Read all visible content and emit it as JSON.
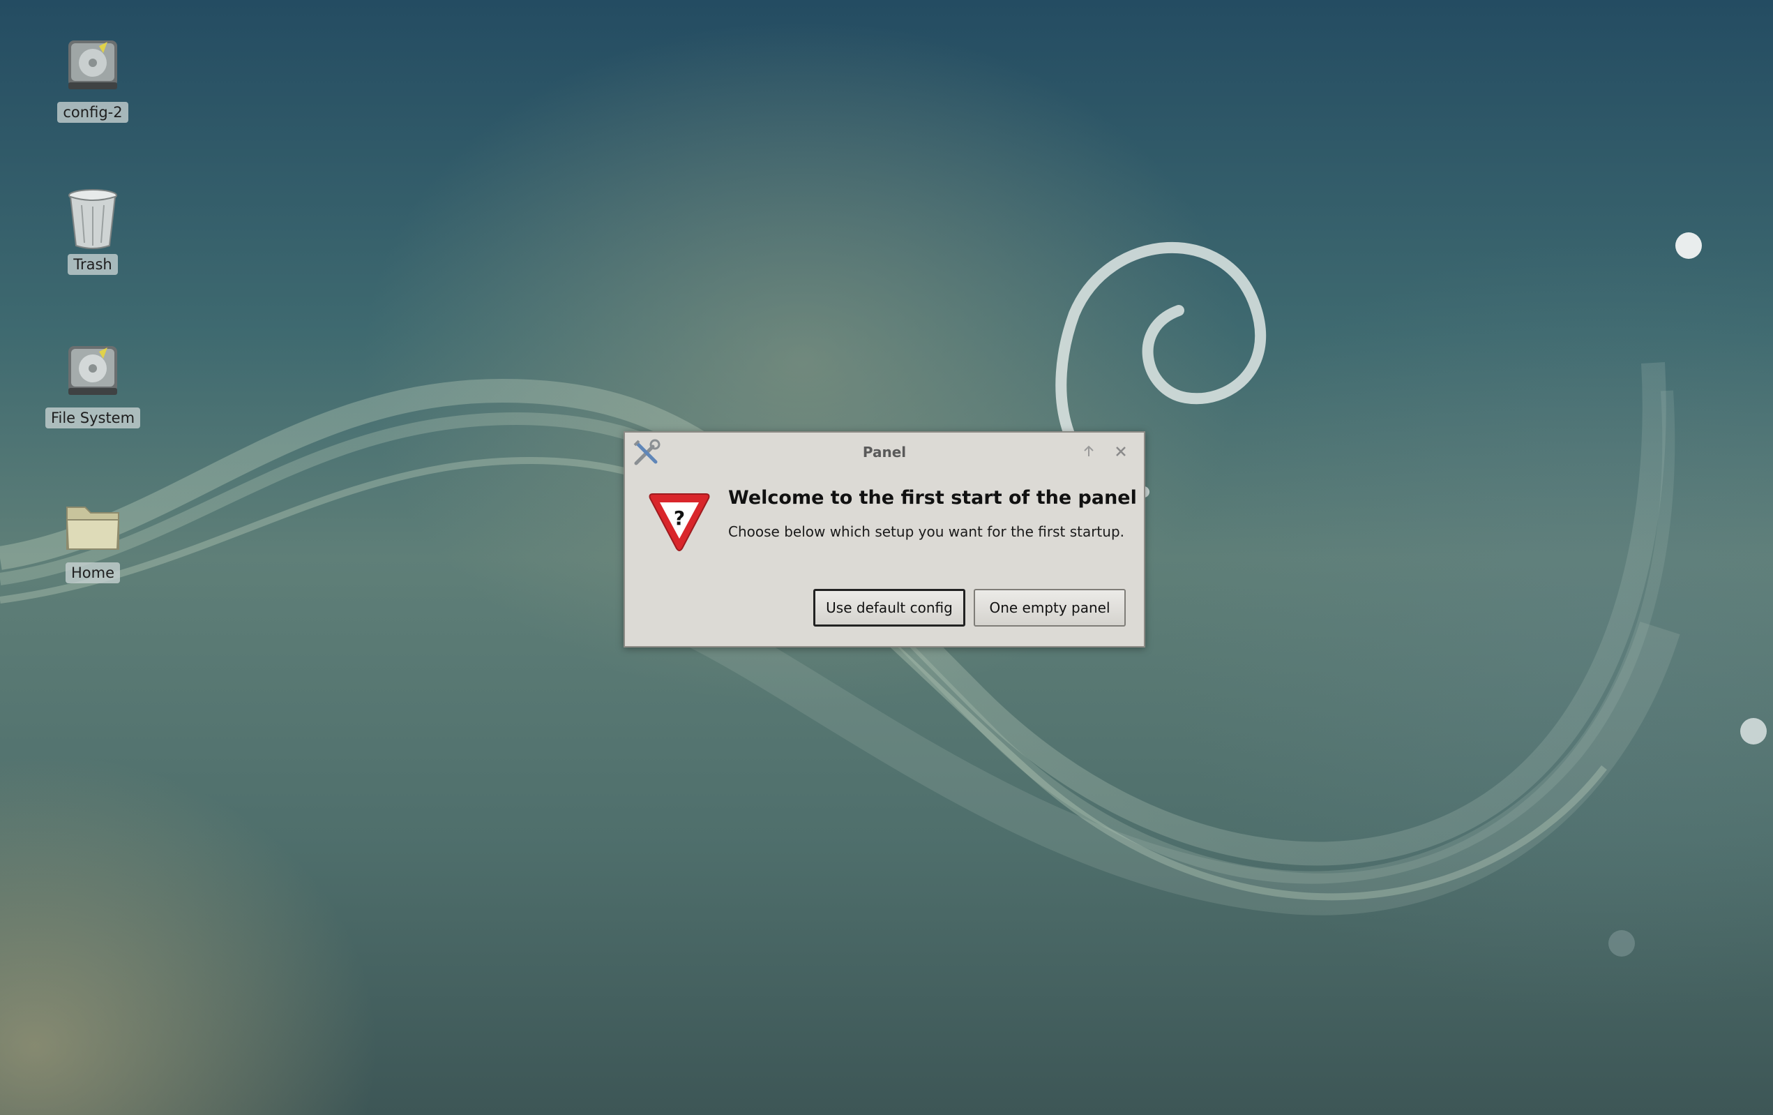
{
  "desktop": {
    "icons": [
      {
        "label": "config-2",
        "icon": "drive-icon"
      },
      {
        "label": "Trash",
        "icon": "trash-icon"
      },
      {
        "label": "File System",
        "icon": "drive-icon"
      },
      {
        "label": "Home",
        "icon": "folder-icon"
      }
    ]
  },
  "dialog": {
    "title": "Panel",
    "heading": "Welcome to the first start of the panel",
    "message": "Choose below which setup you want for the first startup.",
    "buttons": {
      "default_config": "Use default config",
      "empty_panel": "One empty panel"
    },
    "icon": "warning-question-icon",
    "app_icon": "tools-icon"
  },
  "colors": {
    "dialog_bg": "#dcdad5",
    "warning_red": "#d9262b"
  }
}
